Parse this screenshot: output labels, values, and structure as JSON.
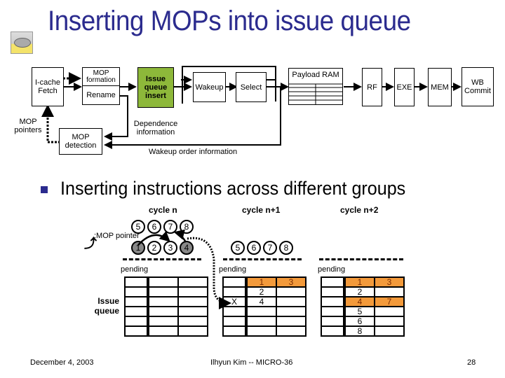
{
  "slide": {
    "title": "Inserting MOPs into issue queue",
    "logo_icon": "sheep-logo-icon",
    "bullet_text": "Inserting instructions across different groups",
    "footer": {
      "date": "December 4, 2003",
      "center": "Ilhyun Kim -- MICRO-36",
      "page": "28"
    }
  },
  "pipeline": {
    "icache_fetch": "I-cache Fetch",
    "mop_formation": "MOP formation",
    "rename": "Rename",
    "issue_queue_insert": "Issue queue insert",
    "wakeup": "Wakeup",
    "select": "Select",
    "payload_ram": "Payload RAM",
    "rf": "RF",
    "exe": "EXE",
    "mem": "MEM",
    "wb_commit": "WB Commit",
    "mop_pointers": "MOP pointers",
    "mop_detection": "MOP detection",
    "dependence_information": "Dependence information",
    "wakeup_order_information": "Wakeup order information",
    "highlight_color": "#8db83a"
  },
  "example": {
    "legend": ":MOP pointer",
    "cycles": [
      "cycle n",
      "cycle n+1",
      "cycle n+2"
    ],
    "cycle_n_top": [
      "5",
      "6",
      "7",
      "8"
    ],
    "cycle_n_bottom": [
      "1",
      "2",
      "3",
      "4"
    ],
    "cycle_n_grey": [
      "1",
      "4"
    ],
    "cycle_n1_row": [
      "5",
      "6",
      "7",
      "8"
    ],
    "pending_label": "pending",
    "issue_queue_label": "Issue queue",
    "blocked_marker": "X",
    "highlight_color": "#f39a3b",
    "queues": [
      {
        "cycle": "cycle n",
        "rows": [
          [
            "",
            "",
            ""
          ],
          [
            "",
            "",
            ""
          ],
          [
            "",
            "",
            ""
          ],
          [
            "",
            "",
            ""
          ],
          [
            "",
            "",
            ""
          ],
          [
            "",
            "",
            ""
          ]
        ]
      },
      {
        "cycle": "cycle n+1",
        "rows": [
          [
            "",
            "1",
            "3"
          ],
          [
            "",
            "2",
            ""
          ],
          [
            "X",
            "4",
            ""
          ],
          [
            "",
            "",
            ""
          ],
          [
            "",
            "",
            ""
          ],
          [
            "",
            "",
            ""
          ]
        ],
        "highlighted_rows": [
          0
        ]
      },
      {
        "cycle": "cycle n+2",
        "rows": [
          [
            "",
            "1",
            "3"
          ],
          [
            "",
            "2",
            ""
          ],
          [
            "",
            "4",
            "7"
          ],
          [
            "",
            "5",
            ""
          ],
          [
            "",
            "6",
            ""
          ],
          [
            "",
            "8",
            ""
          ]
        ],
        "highlighted_rows": [
          0,
          2
        ]
      }
    ]
  }
}
